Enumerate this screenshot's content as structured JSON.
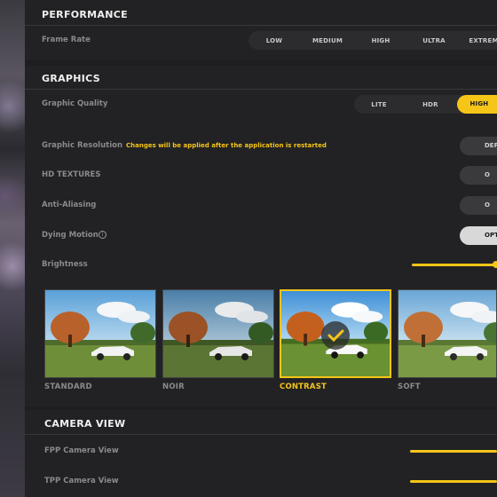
{
  "performance": {
    "title": "PERFORMANCE",
    "frame_rate_label": "Frame Rate",
    "frame_rate_options": [
      "LOW",
      "MEDIUM",
      "HIGH",
      "ULTRA",
      "EXTREM"
    ]
  },
  "graphics": {
    "title": "GRAPHICS",
    "quality_label": "Graphic Quality",
    "quality_options": [
      "LITE",
      "HDR",
      "HIGH"
    ],
    "quality_selected": "HIGH",
    "resolution_label": "Graphic Resolution",
    "resolution_note": "Changes will be applied after the application is restarted",
    "resolution_value": "DEF",
    "hd_textures_label": "HD TEXTURES",
    "hd_textures_value": "O",
    "anti_aliasing_label": "Anti-Aliasing",
    "anti_aliasing_value": "O",
    "dying_motion_label": "Dying Motion",
    "dying_motion_info": "i",
    "dying_motion_value": "OPTI",
    "brightness_label": "Brightness",
    "filters": [
      {
        "label": "STANDARD",
        "selected": false
      },
      {
        "label": "NOIR",
        "selected": false
      },
      {
        "label": "CONTRAST",
        "selected": true
      },
      {
        "label": "SOFT",
        "selected": false
      }
    ]
  },
  "camera": {
    "title": "CAMERA VIEW",
    "fpp_label": "FPP Camera View",
    "tpp_label": "TPP Camera View"
  },
  "colors": {
    "accent": "#f5c518",
    "panel": "#222224",
    "label": "#8a8a8c"
  }
}
